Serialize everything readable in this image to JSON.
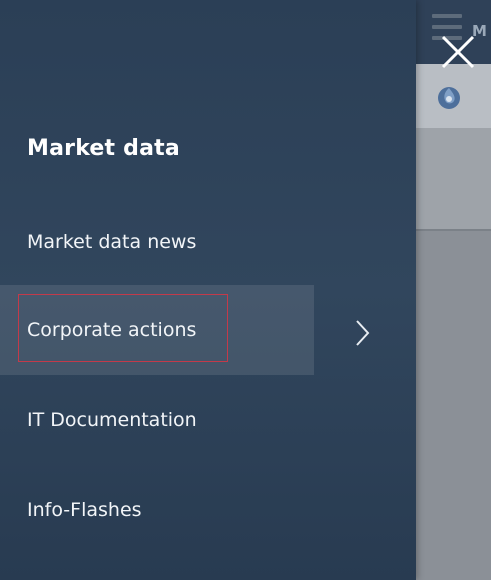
{
  "header": {
    "partial_text": "M"
  },
  "drawer": {
    "section_title": "Market data",
    "items": [
      {
        "label": "Market data news",
        "active": false
      },
      {
        "label": "Corporate actions",
        "active": true,
        "has_submenu": true
      },
      {
        "label": "IT Documentation",
        "active": false
      },
      {
        "label": "Info-Flashes",
        "active": false
      }
    ]
  },
  "icons": {
    "close": "close-icon",
    "submenu": "chevron-right-icon",
    "menu": "hamburger-icon",
    "logo": "logo-icon"
  },
  "colors": {
    "drawer_bg": "#2f435a",
    "highlight_border": "#c33a4a",
    "text": "#ffffff"
  }
}
